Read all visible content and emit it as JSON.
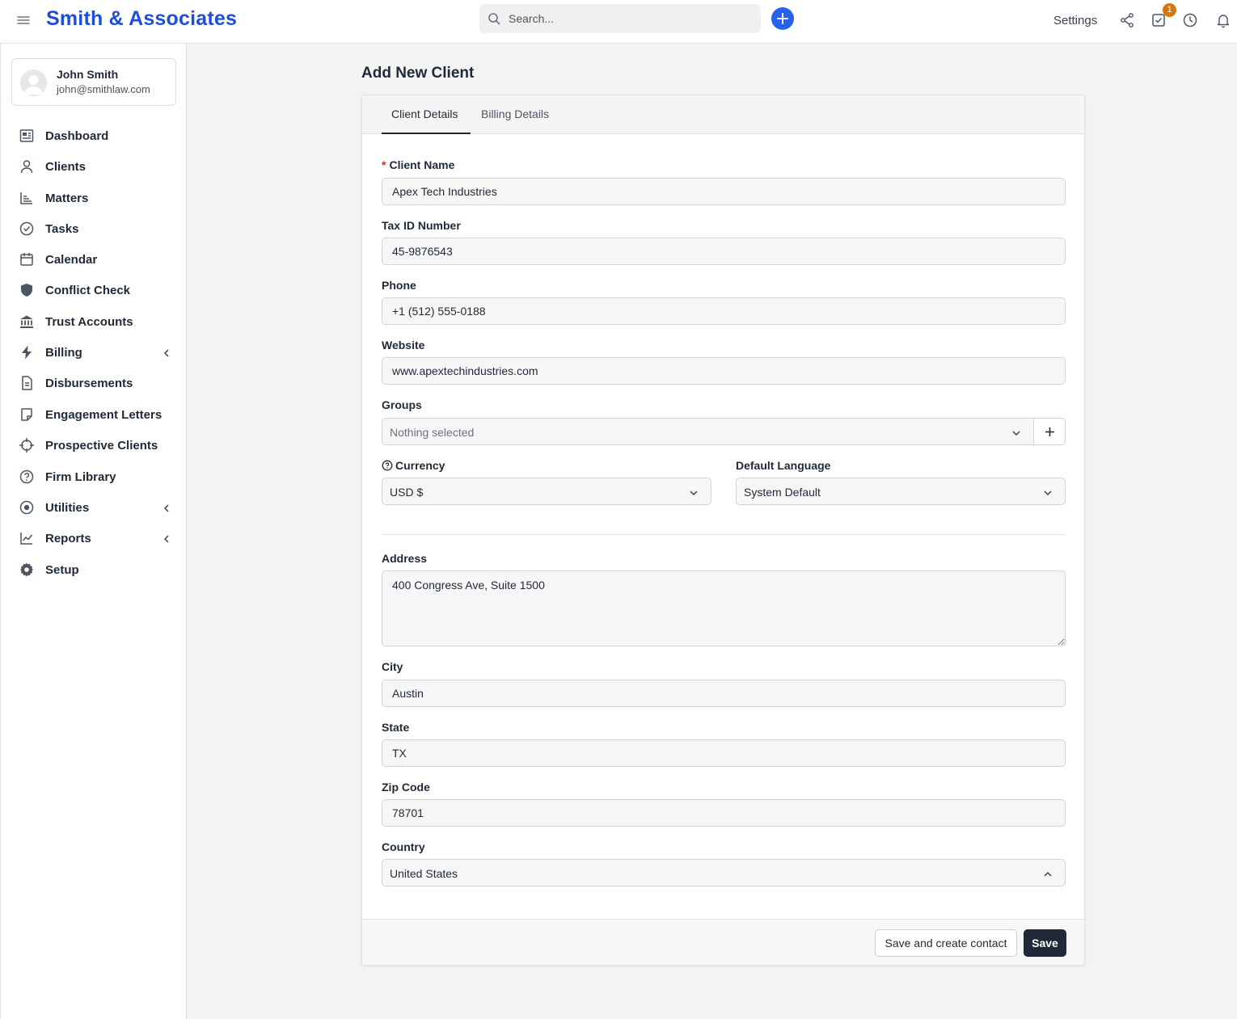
{
  "app": {
    "brand": "Smith & Associates",
    "search_placeholder": "Search...",
    "settings_label": "Settings",
    "tasks_badge": "1",
    "brand_color": "#1d4ed8",
    "accent_color": "#2563eb"
  },
  "user": {
    "name": "John Smith",
    "email": "john@smithlaw.com"
  },
  "sidebar": {
    "items": [
      {
        "label": "Dashboard",
        "icon": "dashboard-icon"
      },
      {
        "label": "Clients",
        "icon": "user-icon"
      },
      {
        "label": "Matters",
        "icon": "matters-icon"
      },
      {
        "label": "Tasks",
        "icon": "check-circle-icon"
      },
      {
        "label": "Calendar",
        "icon": "calendar-icon"
      },
      {
        "label": "Conflict Check",
        "icon": "shield-icon"
      },
      {
        "label": "Trust Accounts",
        "icon": "bank-icon"
      },
      {
        "label": "Billing",
        "icon": "bolt-icon",
        "expandable": true
      },
      {
        "label": "Disbursements",
        "icon": "document-icon"
      },
      {
        "label": "Engagement Letters",
        "icon": "note-icon"
      },
      {
        "label": "Prospective Clients",
        "icon": "crosshair-icon"
      },
      {
        "label": "Firm Library",
        "icon": "help-circle-icon"
      },
      {
        "label": "Utilities",
        "icon": "target-icon",
        "expandable": true
      },
      {
        "label": "Reports",
        "icon": "chart-line-icon",
        "expandable": true
      },
      {
        "label": "Setup",
        "icon": "gear-icon"
      }
    ]
  },
  "page": {
    "title": "Add New Client",
    "tabs": [
      {
        "label": "Client Details",
        "active": true
      },
      {
        "label": "Billing Details",
        "active": false
      }
    ]
  },
  "form": {
    "client_name": {
      "label": "Client Name",
      "value": "Apex Tech Industries",
      "required_mark": "*"
    },
    "tax_id": {
      "label": "Tax ID Number",
      "value": "45-9876543"
    },
    "phone": {
      "label": "Phone",
      "value": "+1 (512) 555-0188"
    },
    "website": {
      "label": "Website",
      "value": "www.apextechindustries.com"
    },
    "groups": {
      "label": "Groups",
      "value": "Nothing selected"
    },
    "currency": {
      "label": "Currency",
      "value": "USD $"
    },
    "language": {
      "label": "Default Language",
      "value": "System Default"
    },
    "address": {
      "label": "Address",
      "value": "400 Congress Ave, Suite 1500"
    },
    "city": {
      "label": "City",
      "value": "Austin"
    },
    "state": {
      "label": "State",
      "value": "TX"
    },
    "zip": {
      "label": "Zip Code",
      "value": "78701"
    },
    "country": {
      "label": "Country",
      "value": "United States"
    }
  },
  "actions": {
    "save_and_create_contact": "Save and create contact",
    "save": "Save"
  }
}
